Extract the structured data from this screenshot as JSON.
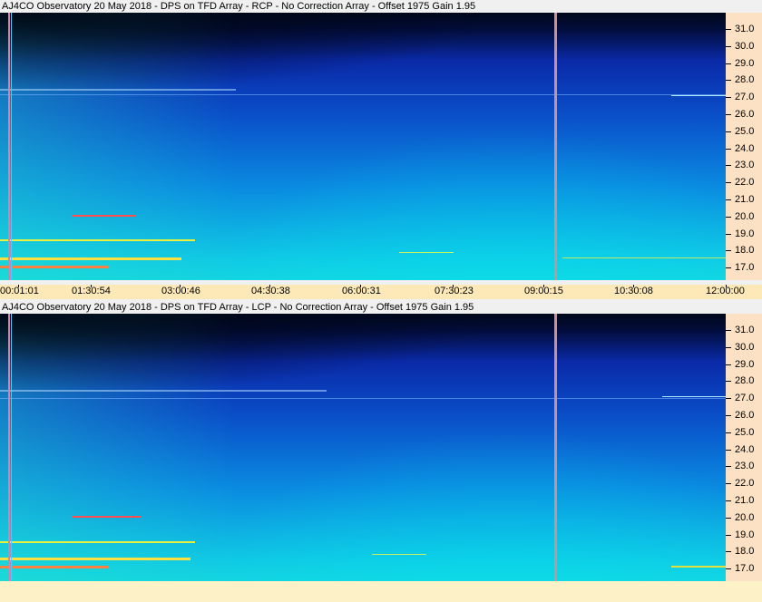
{
  "panels": [
    {
      "id": "rcp",
      "title": "AJ4CO Observatory 20 May 2018 - DPS on TFD Array  - RCP  -  No Correction Array  -  Offset 1975  Gain 1.95",
      "freq_labels": [
        "31.0",
        "30.0",
        "29.0",
        "28.0",
        "27.0",
        "26.0",
        "25.0",
        "24.0",
        "23.0",
        "22.0",
        "21.0",
        "20.0",
        "19.0",
        "18.0",
        "17.0"
      ]
    },
    {
      "id": "lcp",
      "title": "AJ4CO Observatory 20 May 2018 - DPS on TFD Array  - LCP  -  No Correction Array  -  Offset 1975  Gain 1.95",
      "freq_labels": [
        "31.0",
        "30.0",
        "29.0",
        "28.0",
        "27.0",
        "26.0",
        "25.0",
        "24.0",
        "23.0",
        "22.0",
        "21.0",
        "20.0",
        "19.0",
        "18.0",
        "17.0"
      ]
    }
  ],
  "time_labels": [
    "00:01:01",
    "01:30:54",
    "03:00:46",
    "04:30:38",
    "06:00:31",
    "07:30:23",
    "09:00:15",
    "10:30:08",
    "12:00:00"
  ],
  "colors": {
    "axis_bg": "#fde1c4",
    "time_bar_bg": "#fde9b8",
    "marker_line": "#e87aa0"
  }
}
